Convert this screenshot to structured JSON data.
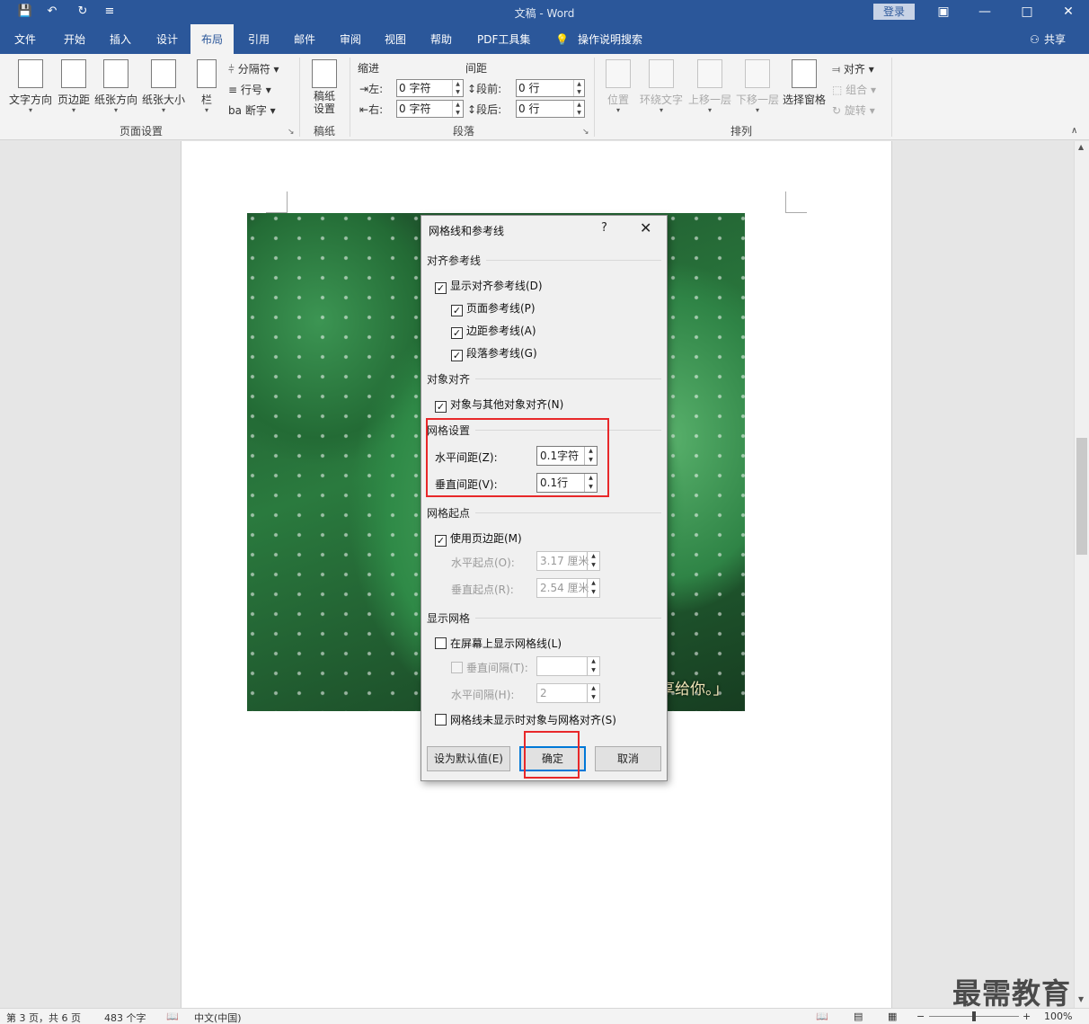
{
  "titlebar": {
    "title": "文稿 - Word",
    "login": "登录"
  },
  "tabs": [
    "文件",
    "开始",
    "插入",
    "设计",
    "布局",
    "引用",
    "邮件",
    "审阅",
    "视图",
    "帮助",
    "PDF工具集",
    "操作说明搜索"
  ],
  "active_tab": "布局",
  "share": "共享",
  "ribbon": {
    "page_setup": {
      "buttons": [
        "文字方向",
        "页边距",
        "纸张方向",
        "纸张大小",
        "栏"
      ],
      "small": [
        "分隔符",
        "行号",
        "断字"
      ],
      "group_label": "页面设置"
    },
    "manuscript": {
      "button": "稿纸\n设置",
      "group_label": "稿纸"
    },
    "paragraph": {
      "indent_label": "缩进",
      "spacing_label": "间距",
      "left_label": "左:",
      "right_label": "右:",
      "before_label": "段前:",
      "after_label": "段后:",
      "left_value": "0 字符",
      "right_value": "0 字符",
      "before_value": "0 行",
      "after_value": "0 行",
      "group_label": "段落"
    },
    "arrange": {
      "buttons": [
        "位置",
        "环绕文字",
        "上移一层",
        "下移一层",
        "选择窗格"
      ],
      "small": [
        "对齐",
        "组合",
        "旋转"
      ],
      "group_label": "排列"
    }
  },
  "photo_caption": "享给你。」",
  "dialog": {
    "title": "网格线和参考线",
    "help": "?",
    "sections": {
      "align_guides": "对齐参考线",
      "object_align": "对象对齐",
      "grid_settings": "网格设置",
      "grid_origin": "网格起点",
      "show_grid": "显示网格"
    },
    "checks": {
      "show_align_guides": {
        "label": "显示对齐参考线(D)",
        "checked": true
      },
      "page_guides": {
        "label": "页面参考线(P)",
        "checked": true
      },
      "margin_guides": {
        "label": "边距参考线(A)",
        "checked": true
      },
      "paragraph_guides": {
        "label": "段落参考线(G)",
        "checked": true
      },
      "align_with_objects": {
        "label": "对象与其他对象对齐(N)",
        "checked": true
      },
      "use_margins": {
        "label": "使用页边距(M)",
        "checked": true
      },
      "show_gridlines": {
        "label": "在屏幕上显示网格线(L)",
        "checked": false
      },
      "vertical_every": {
        "label": "垂直间隔(T):",
        "checked": false
      },
      "snap_when_hidden": {
        "label": "网格线未显示时对象与网格对齐(S)",
        "checked": false
      }
    },
    "fields": {
      "horizontal_spacing": {
        "label": "水平间距(Z):",
        "value": "0.1字符"
      },
      "vertical_spacing": {
        "label": "垂直间距(V):",
        "value": "0.1行"
      },
      "horizontal_origin": {
        "label": "水平起点(O):",
        "value": "3.17 厘米"
      },
      "vertical_origin": {
        "label": "垂直起点(R):",
        "value": "2.54 厘米"
      },
      "vertical_every": {
        "value": ""
      },
      "horizontal_every": {
        "label": "水平间隔(H):",
        "value": "2"
      }
    },
    "buttons": {
      "set_default": "设为默认值(E)",
      "ok": "确定",
      "cancel": "取消"
    }
  },
  "status": {
    "page": "第 3 页，共 6 页",
    "words": "483 个字",
    "language": "中文(中国)",
    "zoom": "100%"
  },
  "watermark": "最需教育",
  "colors": {
    "accent": "#2b579a",
    "highlight": "#e8282a",
    "focus": "#0078d7"
  }
}
